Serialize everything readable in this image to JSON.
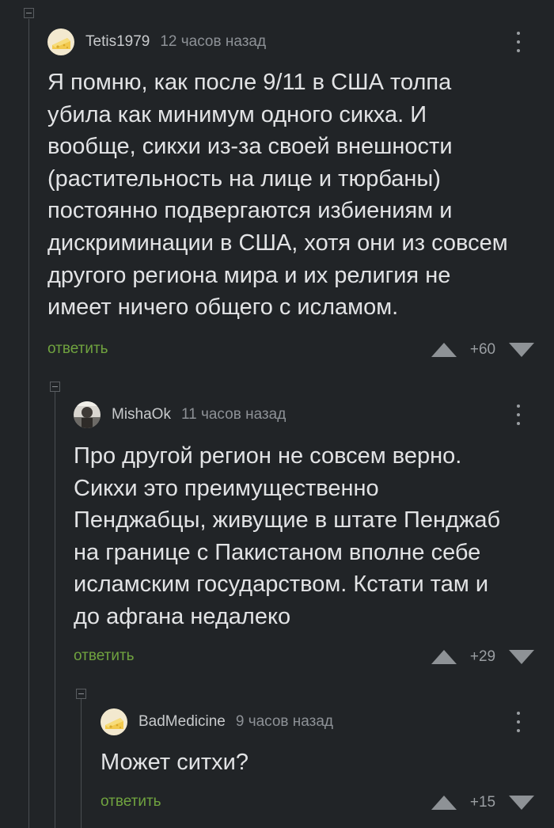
{
  "colors": {
    "background": "#212427",
    "text": "#e2e3e5",
    "muted": "#8d9196",
    "reply_link": "#70a33f",
    "thread_line": "#4a4e52"
  },
  "comments": [
    {
      "author": "Tetis1979",
      "time": "12 часов назад",
      "avatar_icon": "cheese-avatar-icon",
      "body": "Я помню, как после 9/11 в США толпа\nубила как минимум одного сикха. И\nвообще, сикхи из-за своей внешности\n(растительность на лице и тюрбаны)\nпостоянно подвергаются избиениям и\nдискриминации в США, хотя они из совсем\nдругого региона мира и их религия не\nимеет ничего общего с исламом.",
      "reply_label": "ответить",
      "rating": "+60"
    },
    {
      "author": "MishaOk",
      "time": "11 часов назад",
      "avatar_icon": "user-photo-avatar-icon",
      "body": "Про другой регион не совсем верно.\nСикхи это преимущественно\nПенджабцы, живущие в штате Пенджаб\nна границе с Пакистаном вполне себе\nисламским государством. Кстати там и\nдо афгана недалеко",
      "reply_label": "ответить",
      "rating": "+29"
    },
    {
      "author": "BadMedicine",
      "time": "9 часов назад",
      "avatar_icon": "cheese-avatar-icon",
      "body": "Может ситхи?",
      "reply_label": "ответить",
      "rating": "+15"
    }
  ]
}
